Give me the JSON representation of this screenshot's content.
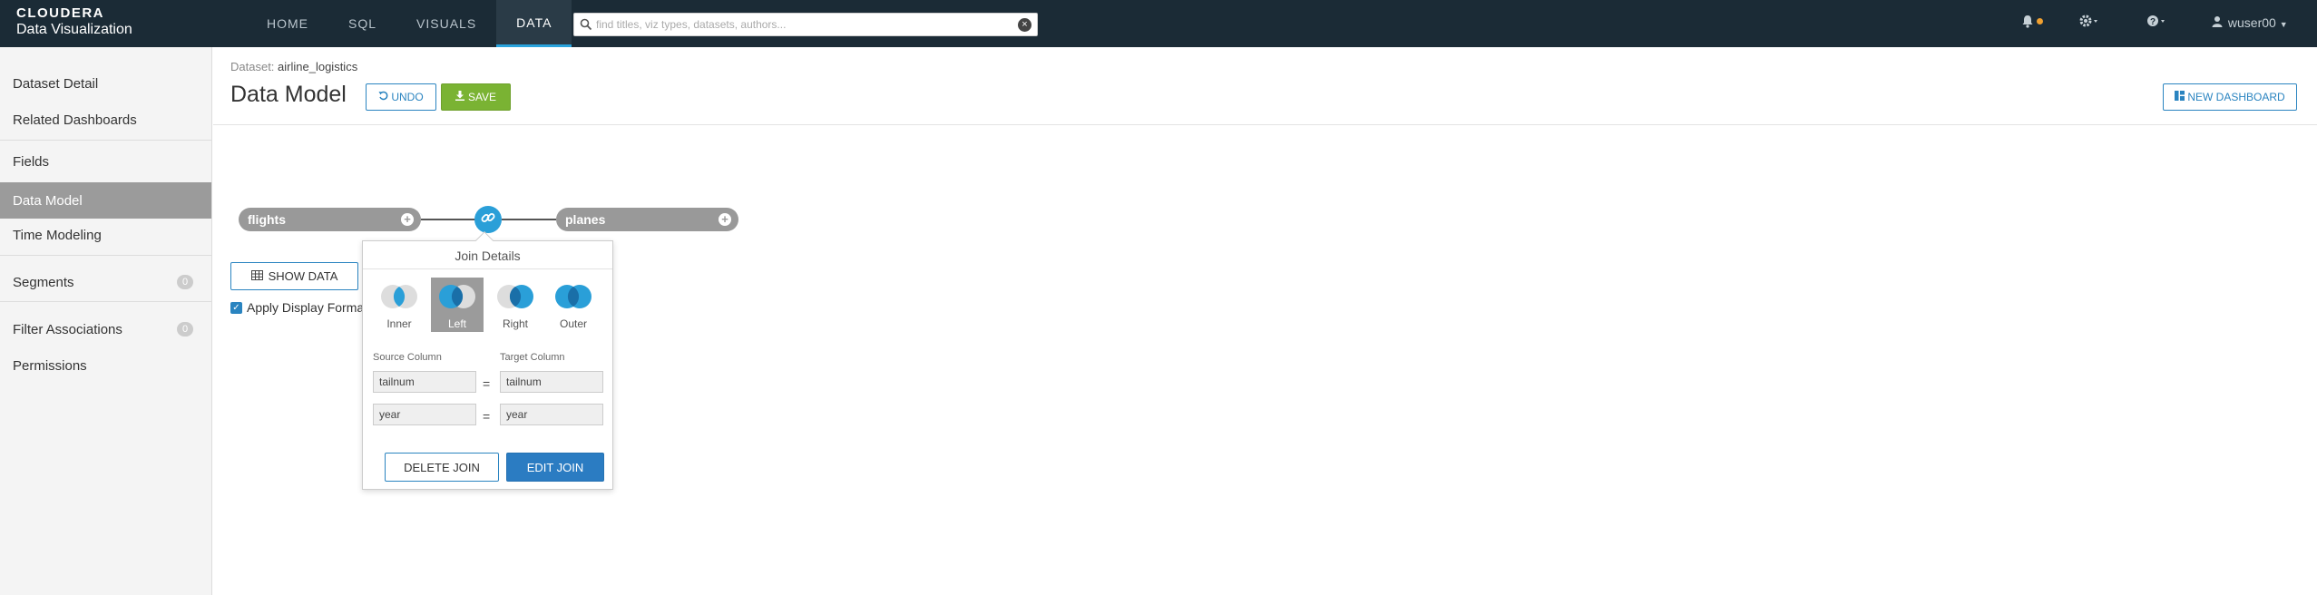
{
  "app": {
    "brand_line1": "CLOUDERA",
    "brand_line2": "Data Visualization"
  },
  "nav": {
    "tabs": [
      {
        "label": "HOME"
      },
      {
        "label": "SQL"
      },
      {
        "label": "VISUALS"
      },
      {
        "label": "DATA"
      }
    ],
    "active": "DATA"
  },
  "search": {
    "placeholder": "find titles, viz types, datasets, authors..."
  },
  "user": {
    "name": "wuser00"
  },
  "colors": {
    "topbar": "#1b2b36",
    "accent": "#29a3dc",
    "save_green": "#7ab333",
    "primary_blue": "#2b7cc2"
  },
  "sidebar": {
    "items": [
      {
        "label": "Dataset Detail"
      },
      {
        "label": "Related Dashboards"
      },
      {
        "label": "Fields"
      },
      {
        "label": "Data Model"
      },
      {
        "label": "Time Modeling"
      },
      {
        "label": "Segments",
        "badge": "0"
      },
      {
        "label": "Filter Associations",
        "badge": "0"
      },
      {
        "label": "Permissions"
      }
    ],
    "active": "Data Model"
  },
  "header": {
    "dataset_prefix": "Dataset:",
    "dataset_name": "airline_logistics",
    "title": "Data Model",
    "undo_label": "UNDO",
    "save_label": "SAVE",
    "new_dashboard_label": "NEW DASHBOARD"
  },
  "model": {
    "left_table": "flights",
    "right_table": "planes",
    "show_data_label": "SHOW DATA",
    "apply_format_label": "Apply Display Format",
    "apply_format_checked": true
  },
  "join_popover": {
    "title": "Join Details",
    "types": [
      {
        "label": "Inner"
      },
      {
        "label": "Left"
      },
      {
        "label": "Right"
      },
      {
        "label": "Outer"
      }
    ],
    "selected": "Left",
    "source_column_label": "Source Column",
    "target_column_label": "Target Column",
    "rows": [
      {
        "source": "tailnum",
        "op": "=",
        "target": "tailnum"
      },
      {
        "source": "year",
        "op": "=",
        "target": "year"
      }
    ],
    "delete_label": "DELETE JOIN",
    "edit_label": "EDIT JOIN"
  }
}
